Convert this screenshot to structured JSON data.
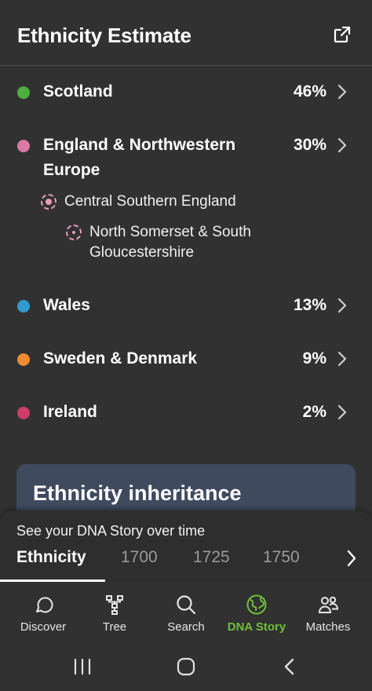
{
  "header": {
    "title": "Ethnicity Estimate",
    "external_icon": "external-link-icon"
  },
  "regions": [
    {
      "name": "Scotland",
      "percent": "46%",
      "color": "#4caf3d"
    },
    {
      "name": "England & Northwestern Europe",
      "percent": "30%",
      "color": "#d97aa3"
    },
    {
      "name": "Wales",
      "percent": "13%",
      "color": "#2f9bd0"
    },
    {
      "name": "Sweden & Denmark",
      "percent": "9%",
      "color": "#ef8b32"
    },
    {
      "name": "Ireland",
      "percent": "2%",
      "color": "#cf3c6a"
    }
  ],
  "subregions": [
    {
      "name": "Central Southern England"
    },
    {
      "name": "North Somerset & South Gloucestershire"
    }
  ],
  "card": {
    "title": "Ethnicity inheritance"
  },
  "timeline": {
    "prompt": "See your DNA Story over time",
    "tabs": [
      "Ethnicity",
      "1700",
      "1725",
      "1750"
    ],
    "active_tab": "Ethnicity"
  },
  "nav": {
    "items": [
      {
        "label": "Discover",
        "icon": "discover-icon"
      },
      {
        "label": "Tree",
        "icon": "tree-icon"
      },
      {
        "label": "Search",
        "icon": "search-icon"
      },
      {
        "label": "DNA Story",
        "icon": "globe-icon"
      },
      {
        "label": "Matches",
        "icon": "matches-icon"
      }
    ],
    "active": "DNA Story",
    "active_color": "#6fbf3a"
  }
}
